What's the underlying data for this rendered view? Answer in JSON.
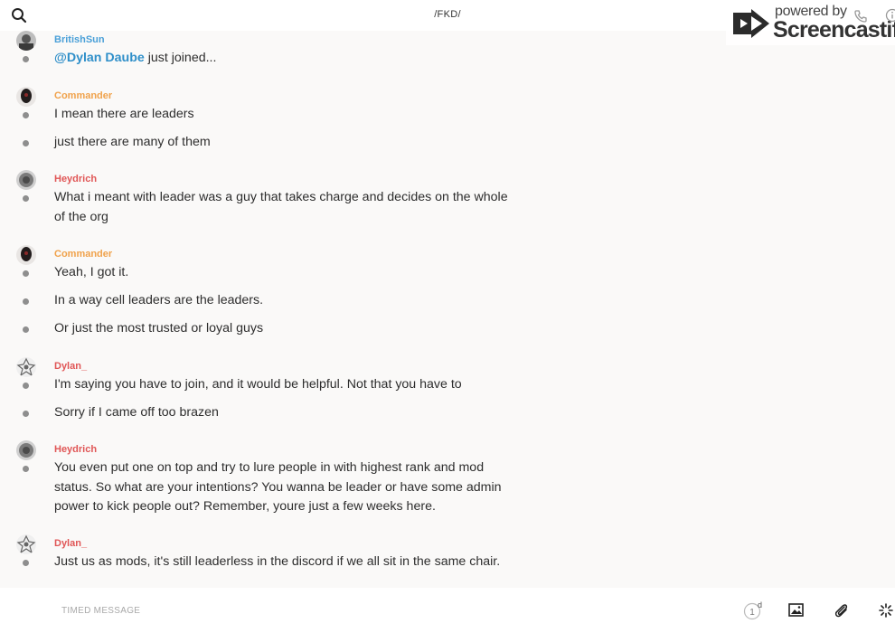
{
  "header": {
    "title": "/FKD/",
    "search_icon": "search-icon"
  },
  "watermark": {
    "powered_by": "powered by",
    "brand": "Screencastify"
  },
  "messages": [
    {
      "sender": "BritishSun",
      "sender_color": "#4aa0d8",
      "lines": [
        {
          "mention": "@Dylan Daube",
          "text": " just joined..."
        }
      ]
    },
    {
      "sender": "Commander",
      "sender_color": "#f0a24b",
      "lines": [
        {
          "text": "I mean there are leaders"
        },
        {
          "text": "just there are many of them"
        }
      ]
    },
    {
      "sender": "Heydrich",
      "sender_color": "#e05656",
      "lines": [
        {
          "text": "What i meant with leader was a guy that takes charge and decides on the whole of the org"
        }
      ]
    },
    {
      "sender": "Commander",
      "sender_color": "#f0a24b",
      "lines": [
        {
          "text": "Yeah, I got it."
        },
        {
          "text": "In a way cell leaders are the leaders."
        },
        {
          "text": "Or just the most trusted or loyal guys"
        }
      ]
    },
    {
      "sender": "Dylan_",
      "sender_color": "#e05656",
      "lines": [
        {
          "text": "I'm saying you have to join, and it would be helpful. Not that you have to"
        },
        {
          "text": "Sorry if I came off too brazen"
        }
      ]
    },
    {
      "sender": "Heydrich",
      "sender_color": "#e05656",
      "lines": [
        {
          "text": "You even put one on top and try to lure people in with highest rank and mod status. So what are your intentions? You wanna be leader or have some admin power to kick people out? Remember, youre just a few weeks here."
        }
      ]
    },
    {
      "sender": "Dylan_",
      "sender_color": "#e05656",
      "lines": [
        {
          "text": "Just us as mods, it's still leaderless in the discord if we all sit in the same chair."
        }
      ]
    }
  ],
  "composer": {
    "placeholder": "TIMED MESSAGE",
    "timer_value": "1",
    "timer_unit": "d"
  }
}
